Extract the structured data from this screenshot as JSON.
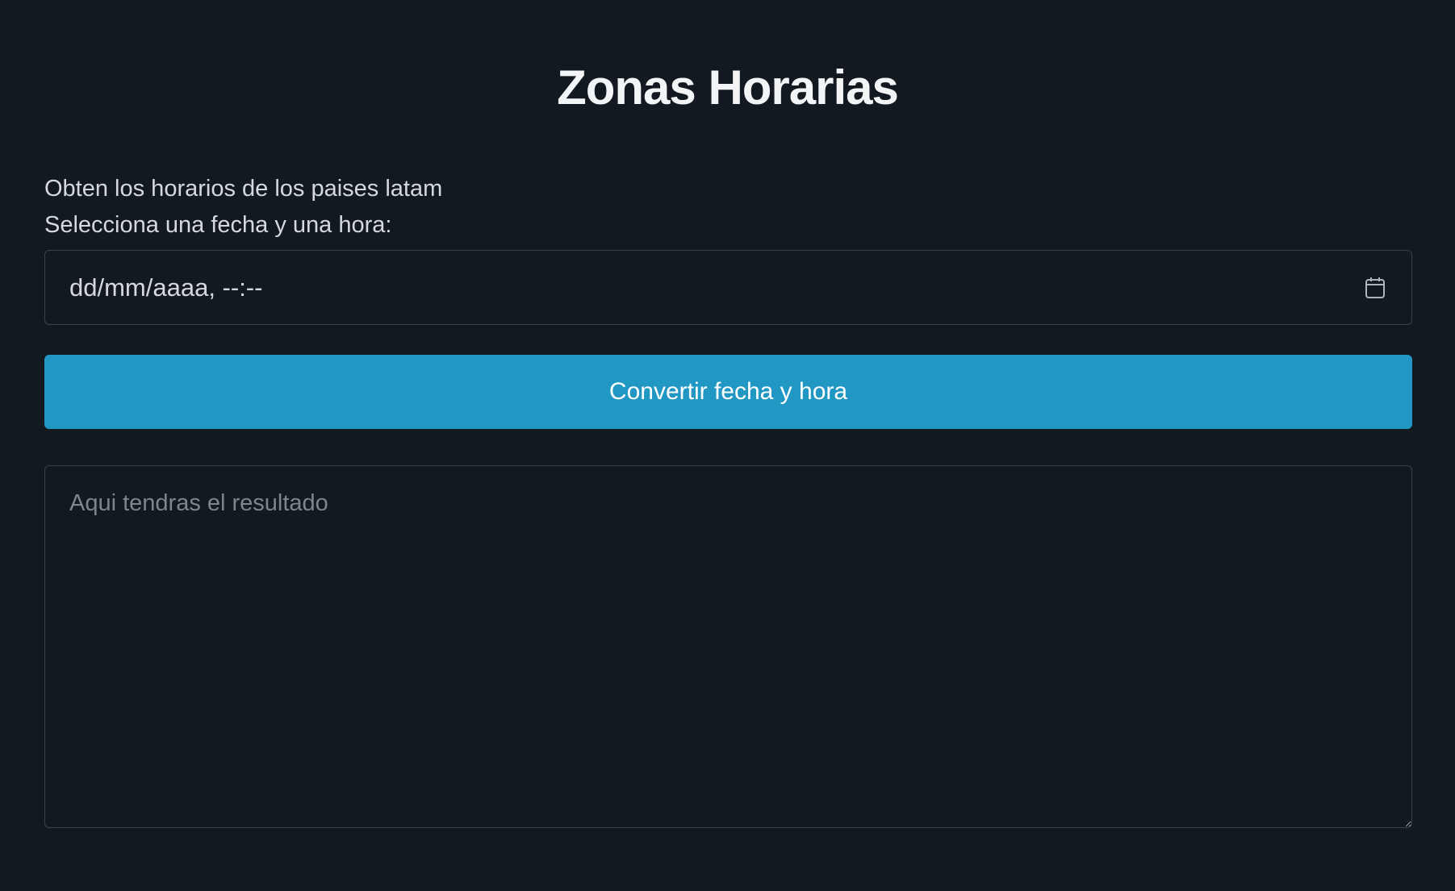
{
  "header": {
    "title": "Zonas Horarias"
  },
  "form": {
    "description": "Obten los horarios de los paises latam",
    "datetime_label": "Selecciona una fecha y una hora:",
    "datetime_placeholder": "dd/mm/aaaa, --:--",
    "datetime_icon": "calendar-icon",
    "convert_button_label": "Convertir fecha y hora",
    "result_placeholder": "Aqui tendras el resultado"
  },
  "colors": {
    "background": "#131920",
    "button": "#2197c3",
    "text": "#d5d9de",
    "border": "#3a4149"
  }
}
